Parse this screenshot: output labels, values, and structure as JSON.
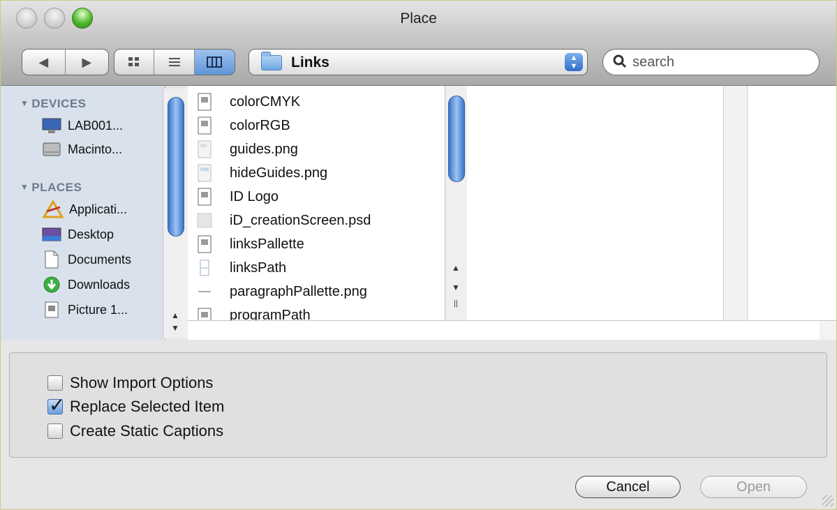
{
  "window": {
    "title": "Place"
  },
  "toolbar": {
    "back_icon": "back-arrow-icon",
    "forward_icon": "forward-arrow-icon",
    "view_modes": [
      "icon-view",
      "list-view",
      "column-view"
    ],
    "active_view": "column-view",
    "location": "Links",
    "search_placeholder": "search"
  },
  "sidebar": {
    "devices_header": "DEVICES",
    "devices": [
      {
        "label": "LAB001...",
        "icon": "computer-icon"
      },
      {
        "label": "Macinto...",
        "icon": "hard-drive-icon"
      }
    ],
    "places_header": "PLACES",
    "places": [
      {
        "label": "Applicati...",
        "icon": "applications-icon"
      },
      {
        "label": "Desktop",
        "icon": "desktop-icon"
      },
      {
        "label": "Documents",
        "icon": "documents-icon"
      },
      {
        "label": "Downloads",
        "icon": "downloads-icon"
      },
      {
        "label": "Picture 1...",
        "icon": "picture-icon"
      }
    ]
  },
  "files": [
    {
      "name": "colorCMYK",
      "icon": "document-icon"
    },
    {
      "name": "colorRGB",
      "icon": "document-icon"
    },
    {
      "name": "guides.png",
      "icon": "image-file-icon"
    },
    {
      "name": "hideGuides.png",
      "icon": "image-file-icon"
    },
    {
      "name": "ID Logo",
      "icon": "document-icon"
    },
    {
      "name": "iD_creationScreen.psd",
      "icon": "psd-file-icon"
    },
    {
      "name": "linksPallette",
      "icon": "document-icon"
    },
    {
      "name": "linksPath",
      "icon": "document-icon"
    },
    {
      "name": "paragraphPallette.png",
      "icon": "image-file-icon"
    },
    {
      "name": "programPath",
      "icon": "document-icon"
    }
  ],
  "options": {
    "show_import": {
      "label": "Show Import Options",
      "checked": false
    },
    "replace_selected": {
      "label": "Replace Selected Item",
      "checked": true
    },
    "static_captions": {
      "label": "Create Static Captions",
      "checked": false
    }
  },
  "buttons": {
    "cancel": "Cancel",
    "open": "Open"
  },
  "colors": {
    "sidebar_bg": "#d9e2ec",
    "accent_blue": "#5f96d8",
    "zoom_green": "#4eb82d"
  }
}
